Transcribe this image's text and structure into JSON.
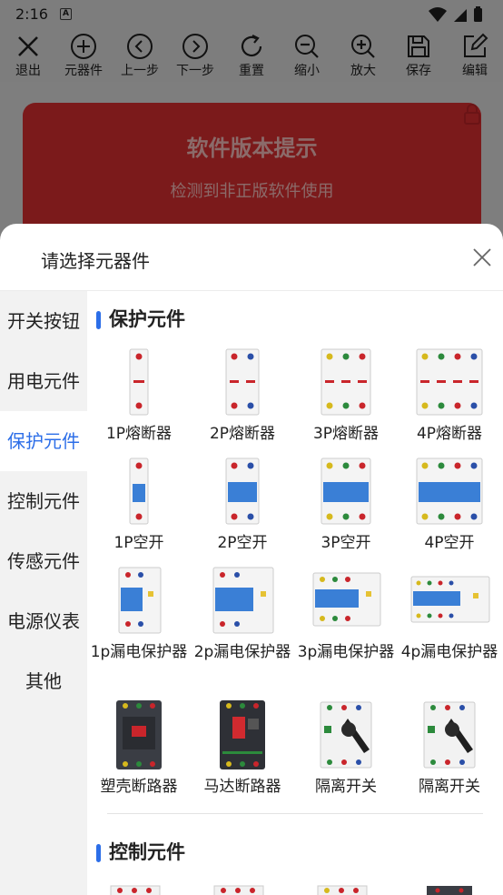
{
  "status": {
    "time": "2:16"
  },
  "toolbar": {
    "items": [
      {
        "label": "退出"
      },
      {
        "label": "元器件"
      },
      {
        "label": "上一步"
      },
      {
        "label": "下一步"
      },
      {
        "label": "重置"
      },
      {
        "label": "缩小"
      },
      {
        "label": "放大"
      },
      {
        "label": "保存"
      },
      {
        "label": "编辑"
      }
    ]
  },
  "canvas": {
    "notice_title": "软件版本提示",
    "notice_text": "检测到非正版软件使用"
  },
  "sheet": {
    "title": "请选择元器件",
    "categories": [
      {
        "label": "开关按钮"
      },
      {
        "label": "用电元件"
      },
      {
        "label": "保护元件",
        "active": true
      },
      {
        "label": "控制元件"
      },
      {
        "label": "传感元件"
      },
      {
        "label": "电源仪表"
      },
      {
        "label": "其他"
      }
    ],
    "sections": [
      {
        "title": "保护元件",
        "items": [
          {
            "label": "1P熔断器"
          },
          {
            "label": "2P熔断器"
          },
          {
            "label": "3P熔断器"
          },
          {
            "label": "4P熔断器"
          },
          {
            "label": "1P空开"
          },
          {
            "label": "2P空开"
          },
          {
            "label": "3P空开"
          },
          {
            "label": "4P空开"
          },
          {
            "label": "1p漏电保护器"
          },
          {
            "label": "2p漏电保护器"
          },
          {
            "label": "3p漏电保护器"
          },
          {
            "label": "4p漏电保护器"
          },
          {
            "label": "塑壳断路器"
          },
          {
            "label": "马达断路器"
          },
          {
            "label": "隔离开关"
          },
          {
            "label": "隔离开关"
          }
        ]
      },
      {
        "title": "控制元件"
      }
    ]
  },
  "colors": {
    "accent": "#2c6ee8",
    "notice_bg": "#7b1a1b",
    "breaker_blue": "#3a7fd6"
  }
}
